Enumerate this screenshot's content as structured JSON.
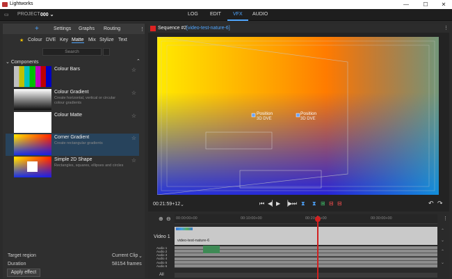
{
  "window": {
    "title": "Lightworks",
    "buttons": [
      "—",
      "☐",
      "✕"
    ]
  },
  "topbar": {
    "project_label": "PROJECT",
    "project_name": "000 ⌄",
    "tabs": [
      "LOG",
      "EDIT",
      "VFX",
      "AUDIO"
    ],
    "active_tab": "VFX"
  },
  "left_panel": {
    "add_symbol": "+",
    "header_tabs": [
      "Settings",
      "Graphs",
      "Routing"
    ],
    "menu_glyph": "⋮",
    "favourite_glyph": "★",
    "sub_tabs": [
      "Colour",
      "DVE",
      "Key",
      "Matte",
      "Mix",
      "Stylize",
      "Text"
    ],
    "active_sub_tab": "Matte",
    "search_placeholder": "Search",
    "components_label": "Components",
    "components": [
      {
        "title": "Colour Bars",
        "desc": ""
      },
      {
        "title": "Colour Gradient",
        "desc": "Create horizontal, vertical or circular colour gradients"
      },
      {
        "title": "Colour Matte",
        "desc": ""
      },
      {
        "title": "Corner Gradient",
        "desc": "Create rectangular gradients"
      },
      {
        "title": "Simple 2D Shape",
        "desc": "Rectangles, squares, ellipses and circles"
      }
    ],
    "target_region_label": "Target region",
    "target_region_value": "Current Clip",
    "duration_label": "Duration",
    "duration_value": "58154 frames",
    "apply_label": "Apply effect"
  },
  "viewer": {
    "sequence": "Sequence #2",
    "clip": "[video-test-nature-6]",
    "timecode": "00:21:59+12",
    "position_labels": [
      {
        "name": "Position",
        "sub": "3D DVE"
      },
      {
        "name": "Position",
        "sub": "3D DVE"
      }
    ]
  },
  "timeline": {
    "ticks": [
      "00:00:00+00",
      "00:10:00+00",
      "00:20:00+00",
      "00:30:00+00"
    ],
    "video_track_label": "Video 1",
    "clip_name": "video-test-nature-6",
    "audio_tracks": [
      "Audio 1",
      "Audio 2",
      "Audio 3",
      "Audio 4",
      "Audio 5",
      "Audio 6"
    ],
    "all_label": "All"
  },
  "colors": {
    "accent": "#4fa6ff",
    "selected": "#27435c",
    "playhead": "#d02020"
  }
}
